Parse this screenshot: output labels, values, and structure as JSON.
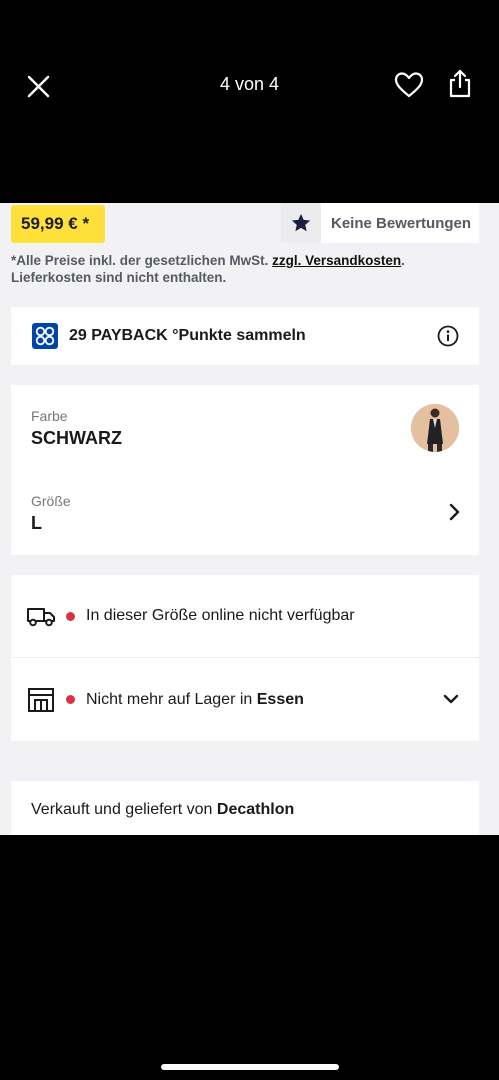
{
  "header": {
    "close_icon": "close-icon",
    "counter": "4 von 4",
    "favorite_icon": "heart-icon",
    "share_icon": "share-icon"
  },
  "price": {
    "value": "59,99 € *",
    "badge_color": "#fde13a"
  },
  "reviews": {
    "icon": "star-icon",
    "label": "Keine Bewertungen"
  },
  "legal": {
    "prefix": "*Alle Preise inkl. der gesetzlichen MwSt. ",
    "shipping_link": "zzgl. Versandkosten",
    "suffix": ". Lieferkosten sind nicht enthalten."
  },
  "payback": {
    "icon": "payback-logo-icon",
    "label": "29 PAYBACK °Punkte sammeln",
    "info_icon": "info-icon",
    "brand_color": "#0046aa"
  },
  "variant": {
    "color_label": "Farbe",
    "color_value": "SCHWARZ",
    "size_label": "Größe",
    "size_value": "L"
  },
  "availability": {
    "status_color": "#d63347",
    "online": {
      "icon": "truck-icon",
      "text": "In dieser Größe online nicht verfügbar"
    },
    "store": {
      "icon": "store-icon",
      "text": "Nicht mehr auf Lager in ",
      "location": "Essen"
    }
  },
  "seller": {
    "text": "Verkauft und geliefert von ",
    "name": "Decathlon"
  }
}
